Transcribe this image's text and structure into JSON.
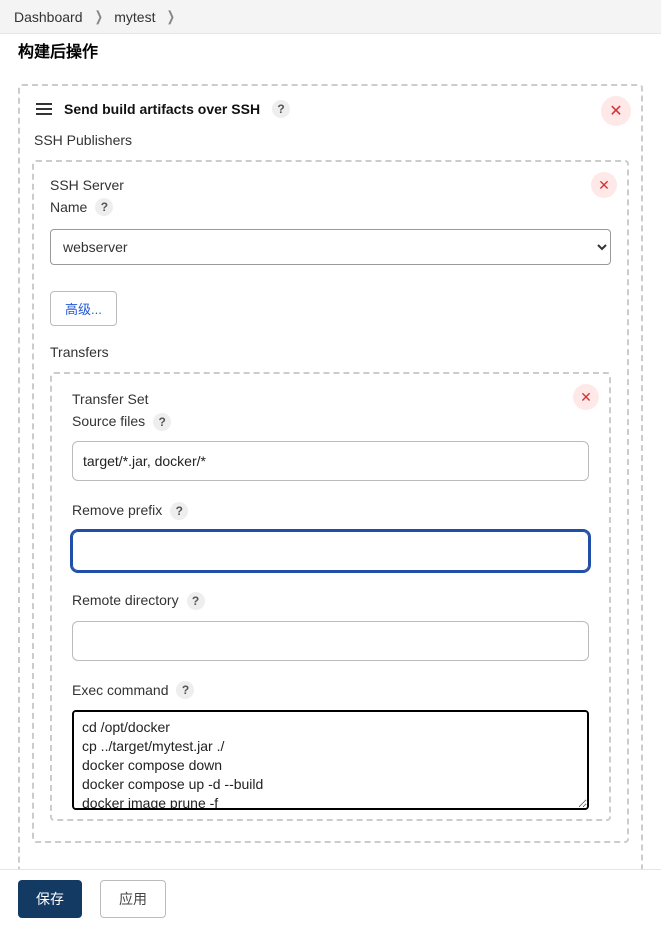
{
  "breadcrumb": {
    "items": [
      "Dashboard",
      "mytest"
    ]
  },
  "section_title": "构建后操作",
  "step": {
    "title": "Send build artifacts over SSH"
  },
  "publishers_label": "SSH Publishers",
  "server": {
    "label1": "SSH Server",
    "label2": "Name",
    "selected": "webserver",
    "advanced_button": "高级..."
  },
  "transfers_label": "Transfers",
  "transfer": {
    "set_label": "Transfer Set",
    "source_files_label": "Source files",
    "source_files_value": "target/*.jar, docker/*",
    "remove_prefix_label": "Remove prefix",
    "remove_prefix_value": "",
    "remote_directory_label": "Remote directory",
    "remote_directory_value": "",
    "exec_command_label": "Exec command",
    "exec_command_value": "cd /opt/docker\ncp ../target/mytest.jar ./\ndocker compose down\ndocker compose up -d --build\ndocker image prune -f"
  },
  "help_glyph": "?",
  "close_glyph": "✕",
  "footer": {
    "save": "保存",
    "apply": "应用"
  }
}
